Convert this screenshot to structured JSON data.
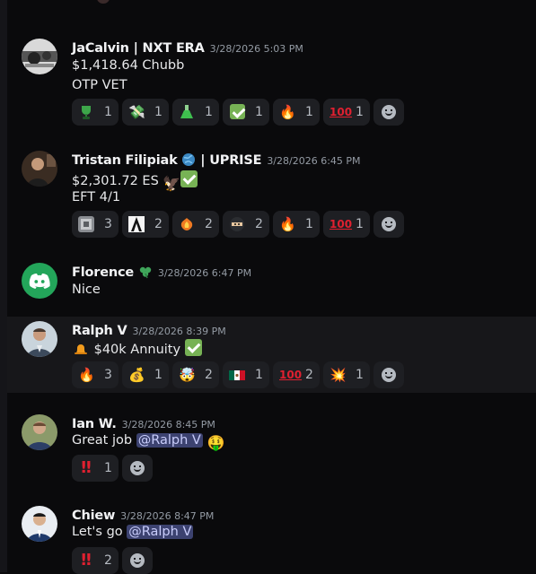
{
  "messages": [
    {
      "username": "JaCalvin | NXT ERA",
      "timestamp": "3/28/2026 5:03 PM",
      "lines": [
        "$1,418.64 Chubb",
        "OTP VET"
      ],
      "reactions": [
        {
          "emoji": "trophy-cup",
          "count": "1"
        },
        {
          "emoji": "money-with-wings",
          "count": "1"
        },
        {
          "emoji": "test-flask",
          "count": "1"
        },
        {
          "emoji": "check-mark",
          "count": "1"
        },
        {
          "emoji": "fire",
          "count": "1"
        },
        {
          "emoji": "hundred-points",
          "count": "1"
        }
      ]
    },
    {
      "username": "Tristan Filipiak",
      "username_suffix": "| UPRISE",
      "timestamp": "3/28/2026 6:45 PM",
      "lines": [
        "$2,301.72 ES",
        "EFT 4/1"
      ],
      "reactions": [
        {
          "emoji": "custom-grey",
          "count": "3"
        },
        {
          "emoji": "custom-letter-a",
          "count": "2"
        },
        {
          "emoji": "custom-phoenix",
          "count": "2"
        },
        {
          "emoji": "custom-ninja",
          "count": "2"
        },
        {
          "emoji": "fire",
          "count": "1"
        },
        {
          "emoji": "hundred-points",
          "count": "1"
        }
      ]
    },
    {
      "username": "Florence",
      "timestamp": "3/28/2026 6:47 PM",
      "lines": [
        "Nice"
      ]
    },
    {
      "username": "Ralph V",
      "timestamp": "3/28/2026 8:39 PM",
      "lines": [
        "$40k Annuity"
      ],
      "reactions": [
        {
          "emoji": "fire",
          "count": "3"
        },
        {
          "emoji": "money-bag",
          "count": "1"
        },
        {
          "emoji": "exploding-head",
          "count": "2"
        },
        {
          "emoji": "mexico-flag",
          "count": "1"
        },
        {
          "emoji": "hundred-points",
          "count": "2"
        },
        {
          "emoji": "collision",
          "count": "1"
        }
      ]
    },
    {
      "username": "Ian W.",
      "timestamp": "3/28/2026 8:45 PM",
      "text": "Great job",
      "mention": "@Ralph V",
      "reactions": [
        {
          "emoji": "double-exclamation",
          "count": "1"
        }
      ]
    },
    {
      "username": "Chiew",
      "timestamp": "3/28/2026 8:47 PM",
      "text": "Let's go",
      "mention": "@Ralph V",
      "reactions": [
        {
          "emoji": "double-exclamation",
          "count": "2"
        }
      ]
    }
  ],
  "icons": {
    "add_reaction": "smile-plus-icon",
    "globe_badge": "globe-icon",
    "clover_badge": "clover-icon",
    "eagle": "eagle-emoji",
    "money_face": "money-mouth-face-emoji",
    "bell": "bell-emoji"
  },
  "colors": {
    "background": "#0a0a0c",
    "highlight": "#17171a",
    "reaction_bg": "#1e1f23",
    "mention_bg": "#3c4270",
    "discord_green": "#23a55a"
  }
}
